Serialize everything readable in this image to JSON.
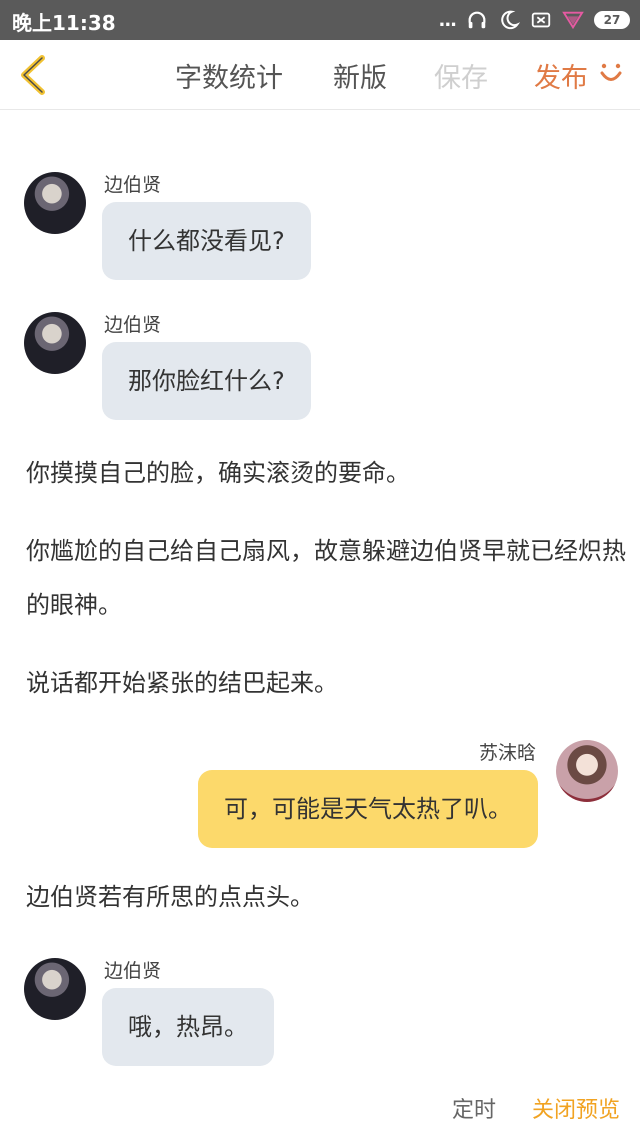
{
  "status_bar": {
    "time": "晚上11:38",
    "battery": "27",
    "dots": "..."
  },
  "toolbar": {
    "word_count": "字数统计",
    "new_version": "新版",
    "save": "保存",
    "publish": "发布",
    "colors": {
      "publish": "#e07a45",
      "save_disabled": "#cfcfcf",
      "back": "#f1c232"
    }
  },
  "messages": [
    {
      "type": "dialog",
      "side": "left",
      "speaker": "边伯贤",
      "text": "什么都没看见?"
    },
    {
      "type": "dialog",
      "side": "left",
      "speaker": "边伯贤",
      "text": "那你脸红什么?"
    },
    {
      "type": "narration",
      "text": "你摸摸自己的脸，确实滚烫的要命。"
    },
    {
      "type": "narration",
      "text": "你尴尬的自己给自己扇风，故意躲避边伯贤早就已经炽热的眼神。"
    },
    {
      "type": "narration",
      "text": "说话都开始紧张的结巴起来。"
    },
    {
      "type": "dialog",
      "side": "right",
      "speaker": "苏沫晗",
      "text": "可，可能是天气太热了叭。"
    },
    {
      "type": "narration",
      "text": "边伯贤若有所思的点点头。"
    },
    {
      "type": "dialog",
      "side": "left",
      "speaker": "边伯贤",
      "text": "哦，热昂。"
    }
  ],
  "bottom_bar": {
    "timer": "定时",
    "close_preview": "关闭预览",
    "colors": {
      "close_preview": "#f1a322"
    }
  }
}
